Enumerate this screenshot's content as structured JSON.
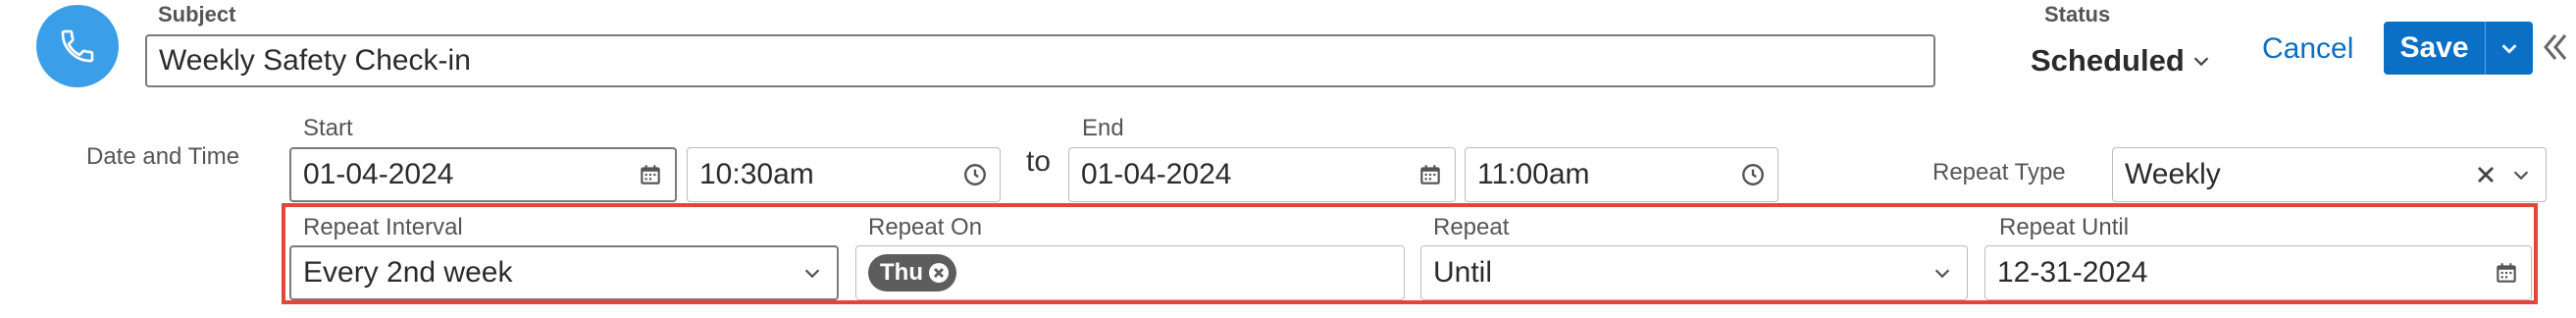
{
  "header": {
    "subject_label": "Subject",
    "subject_value": "Weekly Safety Check-in",
    "status_label": "Status",
    "status_value": "Scheduled",
    "cancel_label": "Cancel",
    "save_label": "Save"
  },
  "datetime": {
    "section_label": "Date and Time",
    "start_label": "Start",
    "start_date": "01-04-2024",
    "start_time": "10:30am",
    "to_label": "to",
    "end_label": "End",
    "end_date": "01-04-2024",
    "end_time": "11:00am",
    "repeat_type_label": "Repeat Type",
    "repeat_type_value": "Weekly"
  },
  "repeat": {
    "interval_label": "Repeat Interval",
    "interval_value": "Every 2nd week",
    "on_label": "Repeat On",
    "on_chips": [
      "Thu"
    ],
    "repeat_label": "Repeat",
    "repeat_value": "Until",
    "until_label": "Repeat Until",
    "until_value": "12-31-2024"
  },
  "colors": {
    "accent": "#0b70c5",
    "highlight_border": "#e0463a",
    "call_icon_bg": "#3a9ee8"
  },
  "icons": [
    "phone-icon",
    "calendar-icon",
    "clock-icon",
    "chevron-down-icon",
    "clear-icon",
    "collapse-icon"
  ]
}
